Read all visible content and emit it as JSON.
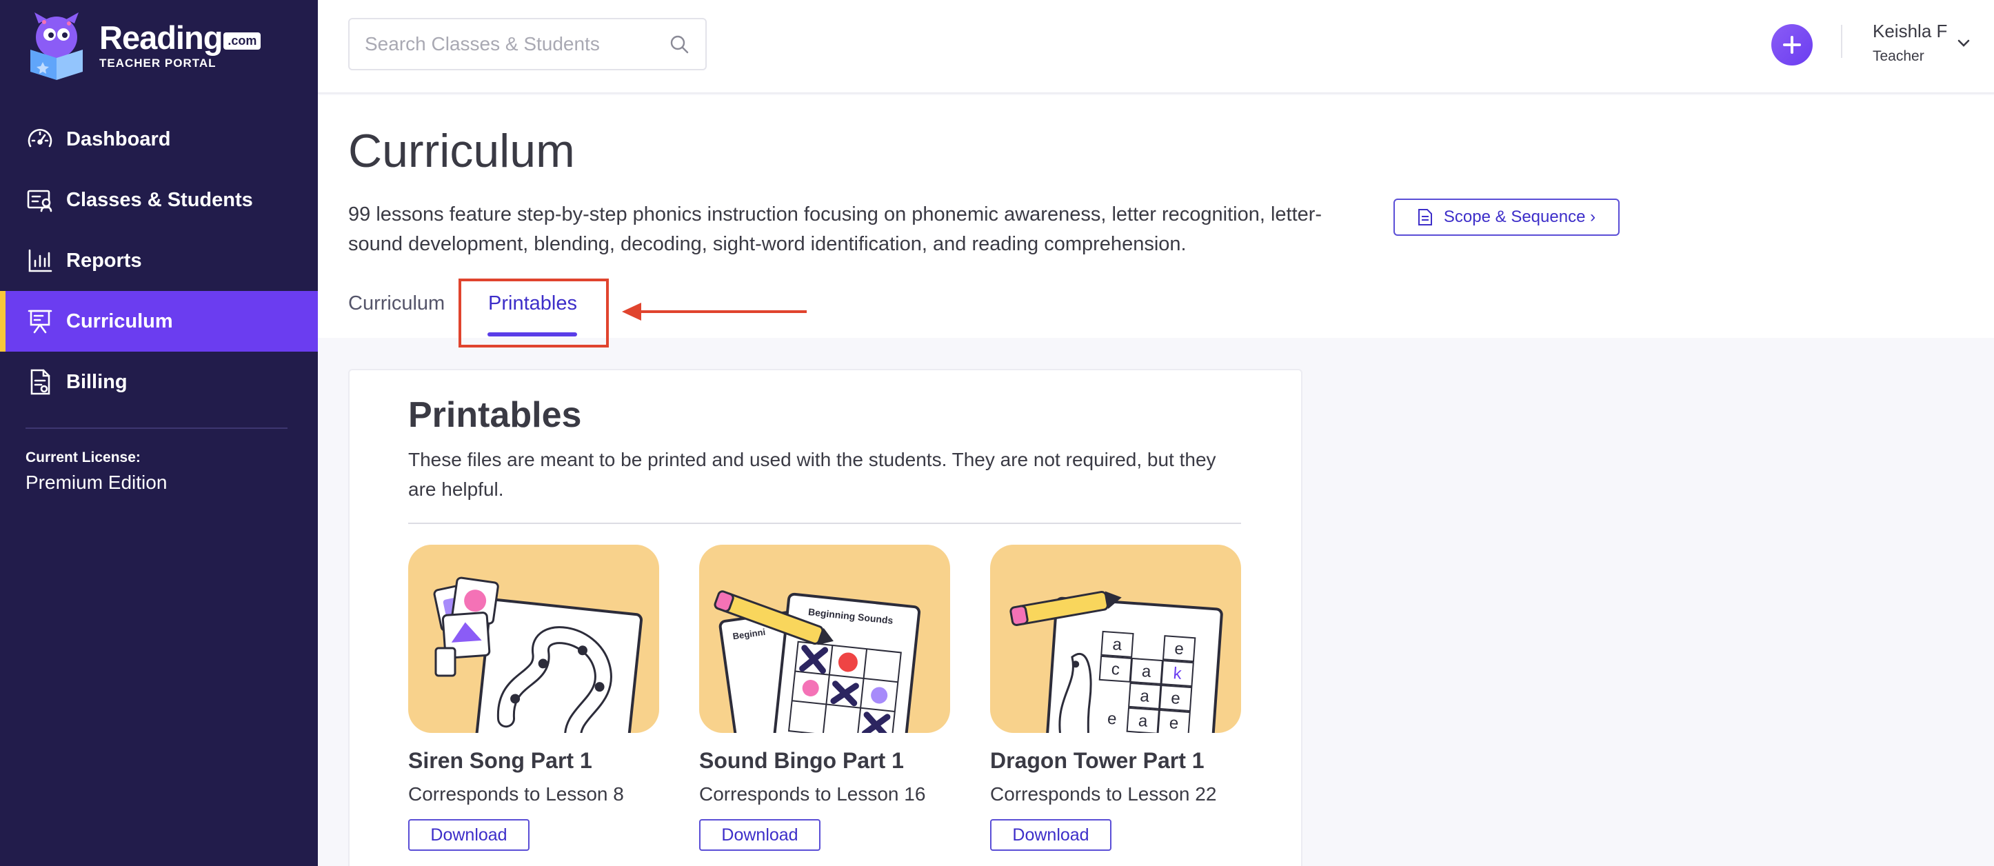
{
  "brand": {
    "name": "Reading",
    "suffix": ".com",
    "subtitle": "TEACHER PORTAL"
  },
  "sidebar": {
    "items": [
      {
        "label": "Dashboard",
        "icon": "gauge-icon"
      },
      {
        "label": "Classes & Students",
        "icon": "roster-icon"
      },
      {
        "label": "Reports",
        "icon": "bar-chart-icon"
      },
      {
        "label": "Curriculum",
        "icon": "presentation-icon",
        "active": true
      },
      {
        "label": "Billing",
        "icon": "invoice-icon"
      }
    ],
    "license_label": "Current License:",
    "license_value": "Premium Edition"
  },
  "header": {
    "search_placeholder": "Search Classes & Students",
    "user_name": "Keishla F",
    "user_role": "Teacher"
  },
  "page": {
    "title": "Curriculum",
    "description": "99 lessons feature step-by-step phonics instruction focusing on phonemic awareness, letter recognition, letter-sound development, blending, decoding, sight-word identification, and reading comprehension.",
    "scope_button": "Scope & Sequence ›",
    "tabs": [
      {
        "label": "Curriculum",
        "active": false
      },
      {
        "label": "Printables",
        "active": true
      }
    ]
  },
  "printables": {
    "title": "Printables",
    "description": "These files are meant to be printed and used with the students. They are not required, but they are helpful.",
    "items": [
      {
        "title": "Siren Song Part 1",
        "subtitle": "Corresponds to Lesson 8",
        "button": "Download"
      },
      {
        "title": "Sound Bingo Part 1",
        "subtitle": "Corresponds to Lesson 16",
        "button": "Download",
        "sheet_title": "Beginning Sounds",
        "sheet_title_back": "Beginni"
      },
      {
        "title": "Dragon Tower Part 1",
        "subtitle": "Corresponds to Lesson 22",
        "button": "Download",
        "letters": [
          "a",
          "e",
          "c",
          "a",
          "k",
          "e",
          "a",
          "e",
          "a",
          "e"
        ]
      }
    ]
  },
  "colors": {
    "sidebar": "#221c4b",
    "accent": "#6b3df0",
    "active_marker": "#f9c63a",
    "annotation": "#e0442e",
    "thumb_bg": "#f8d28c"
  }
}
